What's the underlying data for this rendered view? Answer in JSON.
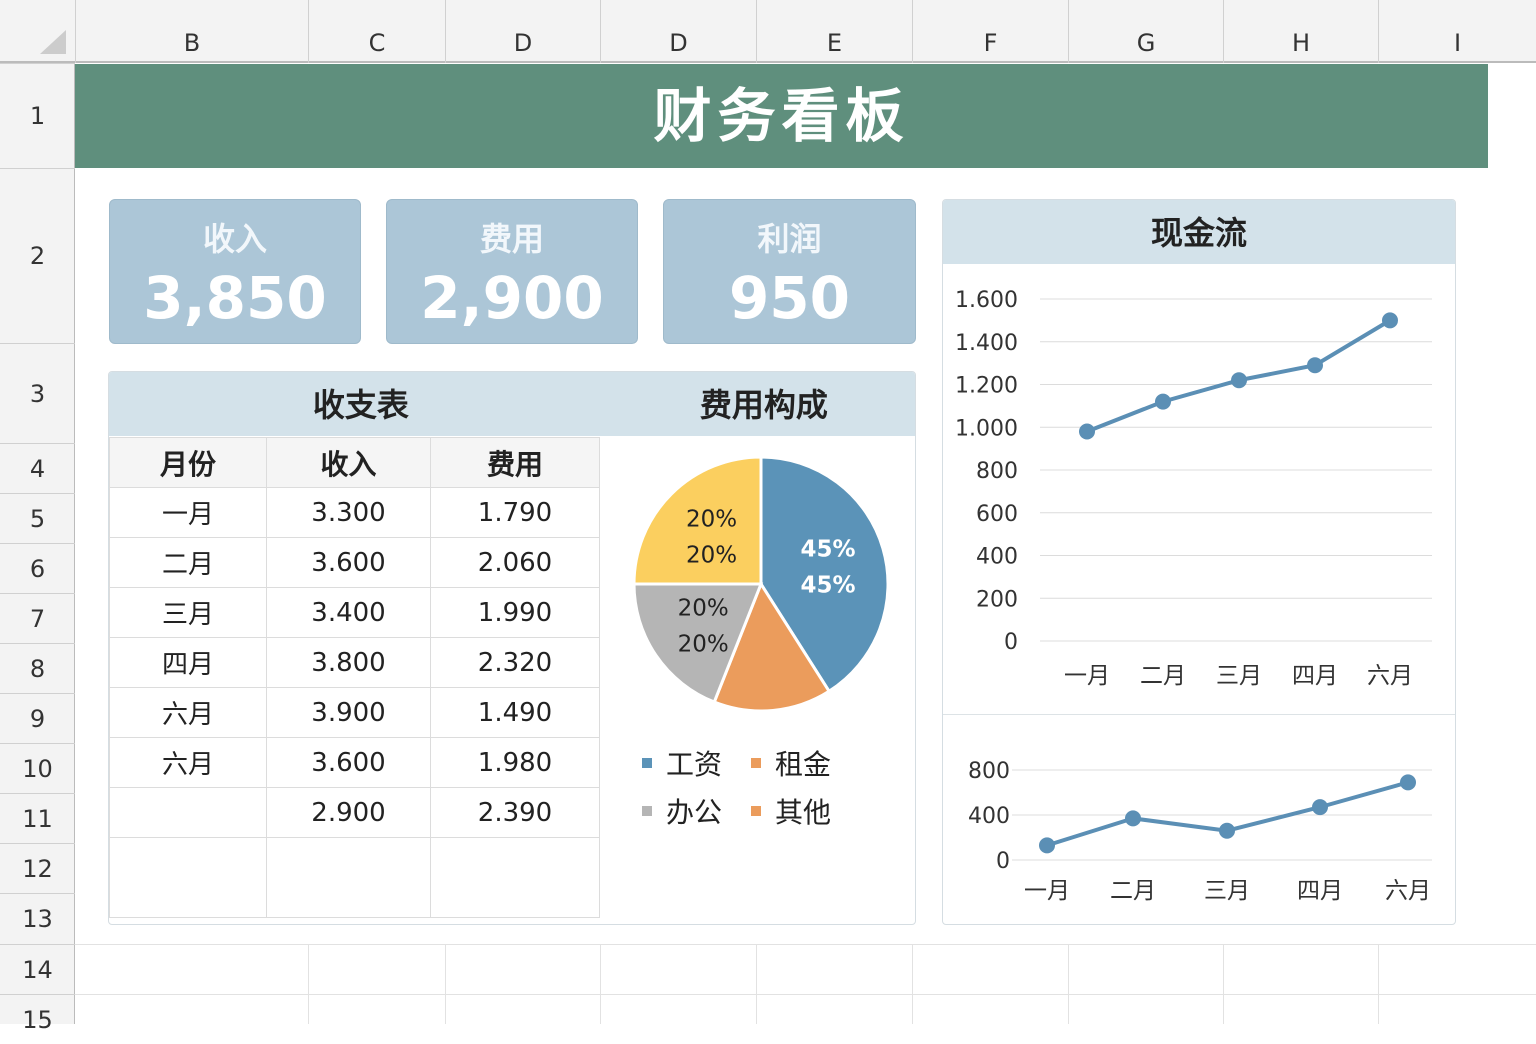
{
  "columns": [
    "B",
    "C",
    "D",
    "D",
    "E",
    "F",
    "G",
    "H",
    "I"
  ],
  "rows": [
    "1",
    "2",
    "3",
    "4",
    "5",
    "6",
    "7",
    "8",
    "9",
    "10",
    "11",
    "12",
    "13",
    "14",
    "15"
  ],
  "title": "财务看板",
  "kpis": [
    {
      "label": "收入",
      "value": "3,850"
    },
    {
      "label": "费用",
      "value": "2,900"
    },
    {
      "label": "利润",
      "value": "950"
    }
  ],
  "table": {
    "title": "收支表",
    "headers": [
      "月份",
      "收入",
      "费用"
    ],
    "rows": [
      [
        "一月",
        "3.300",
        "1.790"
      ],
      [
        "二月",
        "3.600",
        "2.060"
      ],
      [
        "三月",
        "3.400",
        "1.990"
      ],
      [
        "四月",
        "3.800",
        "2.320"
      ],
      [
        "六月",
        "3.900",
        "1.490"
      ],
      [
        "六月",
        "3.600",
        "1.980"
      ],
      [
        "",
        "2.900",
        "2.390"
      ],
      [
        "",
        "",
        ""
      ]
    ]
  },
  "chart_data": [
    {
      "type": "pie",
      "title": "费用构成",
      "slices": [
        {
          "name": "工资",
          "value": 41,
          "labels": [
            "45%",
            "45%"
          ],
          "color": "#5b93b8"
        },
        {
          "name": "租金",
          "value": 15,
          "labels": [],
          "color": "#eb9c5c"
        },
        {
          "name": "办公",
          "value": 19,
          "labels": [
            "20%",
            "20%"
          ],
          "color": "#b5b5b5"
        },
        {
          "name": "其他",
          "value": 25,
          "labels": [
            "20%",
            "20%"
          ],
          "color": "#fbcf5f"
        }
      ],
      "legend": [
        {
          "name": "工资",
          "color": "#5b93b8"
        },
        {
          "name": "租金",
          "color": "#eb9c5c"
        },
        {
          "name": "办公",
          "color": "#b5b5b5"
        },
        {
          "name": "其他",
          "color": "#eb9c5c"
        }
      ]
    },
    {
      "type": "line",
      "title": "现金流",
      "categories": [
        "一月",
        "二月",
        "三月",
        "四月",
        "六月"
      ],
      "values": [
        980,
        1120,
        1220,
        1290,
        1500
      ],
      "ylim": [
        0,
        1600
      ],
      "yticks": [
        "0",
        "200",
        "400",
        "600",
        "800",
        "1.000",
        "1.200",
        "1.400",
        "1.600"
      ],
      "color": "#5b8fb5"
    },
    {
      "type": "line",
      "title": "",
      "categories": [
        "一月",
        "二月",
        "三月",
        "四月",
        "六月"
      ],
      "values": [
        130,
        370,
        260,
        470,
        690
      ],
      "ylim": [
        0,
        800
      ],
      "yticks": [
        "0",
        "400",
        "800"
      ],
      "color": "#5b8fb5"
    }
  ]
}
